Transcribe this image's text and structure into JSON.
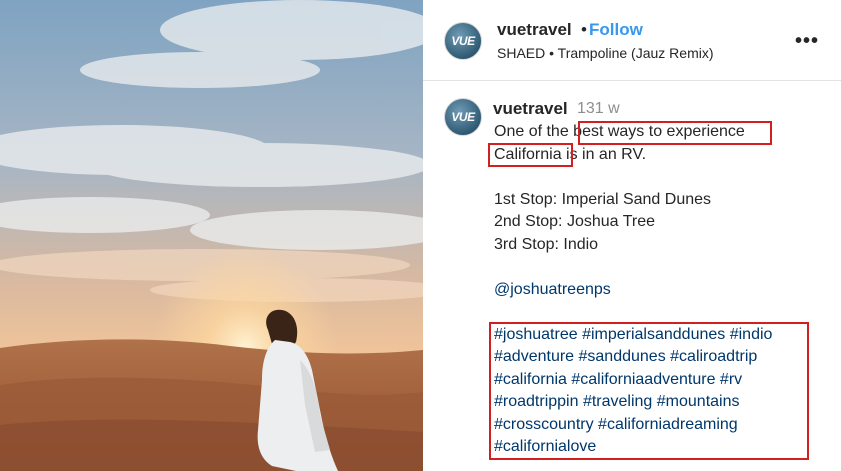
{
  "post": {
    "username": "vuetravel",
    "avatar_text": "VUE",
    "follow_separator": "•",
    "follow_label": "Follow",
    "music": "SHAED • Trampoline (Jauz Remix)",
    "more_icon": "more-horizontal-icon"
  },
  "caption": {
    "username": "vuetravel",
    "time": "131 w",
    "line1": "One of the best ways to experience",
    "line2": "California is in an RV.",
    "stop1": "1st Stop: Imperial Sand Dunes",
    "stop2": "2nd Stop: Joshua Tree",
    "stop3": "3rd Stop: Indio",
    "mention": "@joshuatreenps",
    "hashtags": [
      "#joshuatree #imperialsanddunes #indio",
      "#adventure #sanddunes #caliroadtrip",
      "#california #californiaadventure #rv",
      "#roadtrippin #traveling #mountains",
      "#crosscountry #californiadreaming",
      "#californialove"
    ]
  },
  "colors": {
    "follow": "#3897f0",
    "highlight_box": "#d21f1f",
    "link": "#00376b"
  }
}
